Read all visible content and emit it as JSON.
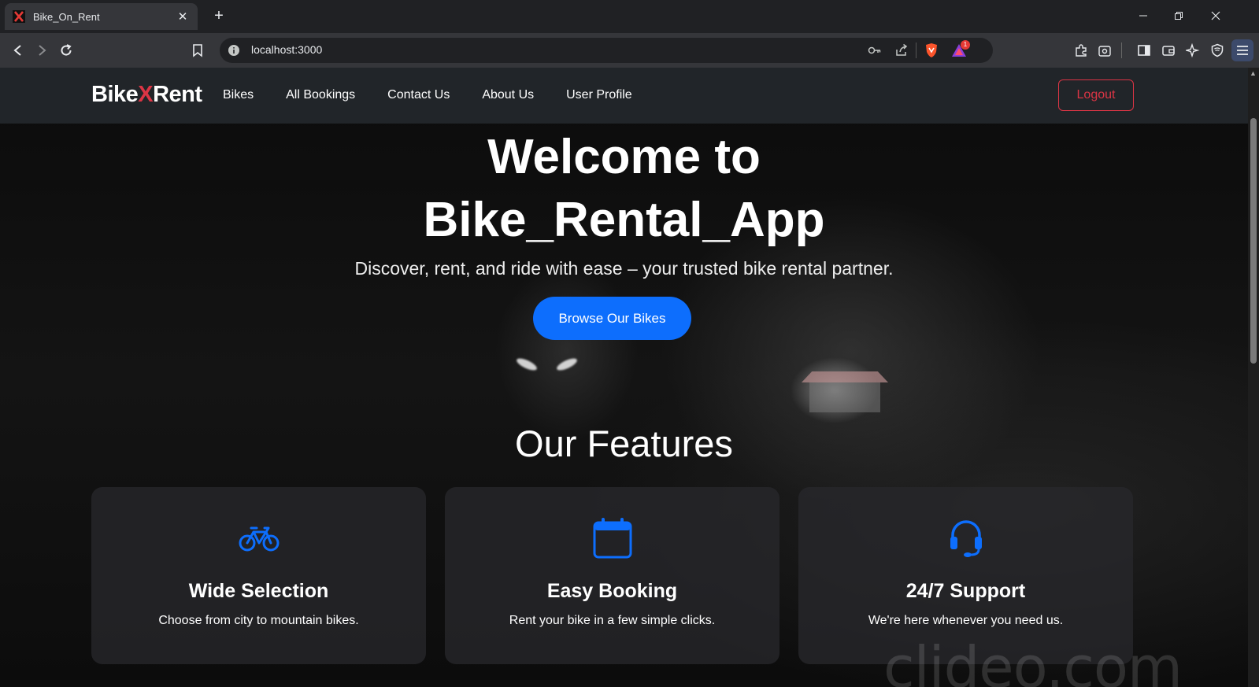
{
  "browser": {
    "tab_title": "Bike_On_Rent",
    "tab_close": "✕",
    "new_tab": "+",
    "url": "localhost:3000",
    "notification_count": "1"
  },
  "navbar": {
    "brand_part1": "Bike",
    "brand_part2": "X",
    "brand_part3": "Rent",
    "links": [
      "Bikes",
      "All Bookings",
      "Contact Us",
      "About Us",
      "User Profile"
    ],
    "logout_label": "Logout"
  },
  "hero": {
    "title_line1": "Welcome to",
    "title_line2": "Bike_Rental_App",
    "subtitle": "Discover, rent, and ride with ease – your trusted bike rental partner.",
    "cta_label": "Browse Our Bikes"
  },
  "features": {
    "heading": "Our Features",
    "cards": [
      {
        "icon": "bicycle-icon",
        "title": "Wide Selection",
        "text": "Choose from city to mountain bikes."
      },
      {
        "icon": "calendar-icon",
        "title": "Easy Booking",
        "text": "Rent your bike in a few simple clicks."
      },
      {
        "icon": "headset-icon",
        "title": "24/7 Support",
        "text": "We're here whenever you need us."
      }
    ]
  },
  "watermark": "clideo.com",
  "colors": {
    "accent": "#0d6efd",
    "danger": "#dc3545",
    "navbar_bg": "#212529"
  }
}
